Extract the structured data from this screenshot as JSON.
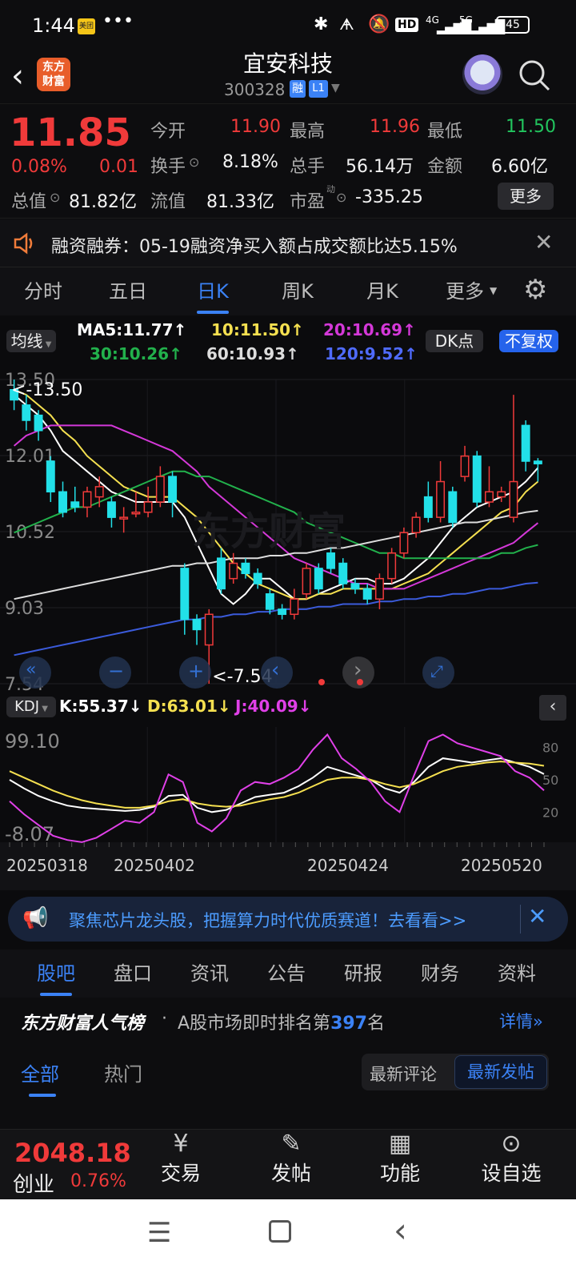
{
  "status": {
    "time": "1:44",
    "app_badge": "美团",
    "dots": "•••",
    "hd": "HD",
    "net1": "4G",
    "net2": "5G",
    "battery": "45"
  },
  "header": {
    "logo_line1": "东方",
    "logo_line2": "财富",
    "stock_name": "宜安科技",
    "stock_code": "300328",
    "tag_rong": "融",
    "tag_l1": "L1"
  },
  "quote": {
    "price": "11.85",
    "change_pct": "0.08%",
    "change": "0.01",
    "open_label": "今开",
    "open": "11.90",
    "high_label": "最高",
    "high": "11.96",
    "low_label": "最低",
    "low": "11.50",
    "turnover_label": "换手",
    "turnover": "8.18%",
    "volume_label": "总手",
    "volume": "56.14万",
    "amount_label": "金额",
    "amount": "6.60亿",
    "mcap_label": "总值",
    "mcap": "81.82亿",
    "float_label": "流值",
    "float": "81.33亿",
    "pe_label": "市盈",
    "pe_sup": "动",
    "pe": "-335.25",
    "more_button": "更多"
  },
  "notice": {
    "text": "融资融券：05-19融资净买入额占成交额比达5.15%"
  },
  "period_tabs": [
    {
      "label": "分时"
    },
    {
      "label": "五日"
    },
    {
      "label": "日K"
    },
    {
      "label": "周K"
    },
    {
      "label": "月K"
    },
    {
      "label": "更多"
    }
  ],
  "ma_legend": {
    "selector": "均线",
    "ma5": "MA5:11.77",
    "ma10": "10:11.50",
    "ma20": "20:10.69",
    "ma30": "30:10.26",
    "ma60": "60:10.93",
    "ma120": "120:9.52",
    "dk_button": "DK点",
    "fq_button": "不复权"
  },
  "colors": {
    "up": "#f03a3a",
    "down": "#22e0e8",
    "ma5": "#ffffff",
    "ma10": "#f5e050",
    "ma20": "#d438d8",
    "ma30": "#22b14c",
    "ma60": "#dddddd",
    "ma120": "#3b5bdb",
    "accent": "#3b82f6"
  },
  "chart_data": [
    {
      "type": "candlestick",
      "y_ticks": [
        "13.50",
        "12.01",
        "10.52",
        "9.03",
        "7.54"
      ],
      "ylim": [
        7.54,
        13.5
      ],
      "high_marker": "<-13.50",
      "low_marker": "<-7.54",
      "x_labels": [
        "20250318",
        "20250402",
        "20250424",
        "20250520"
      ],
      "candles": [
        {
          "o": 13.3,
          "c": 13.1,
          "h": 13.5,
          "l": 12.9
        },
        {
          "o": 13.0,
          "c": 12.7,
          "h": 13.2,
          "l": 12.5
        },
        {
          "o": 12.8,
          "c": 12.5,
          "h": 12.9,
          "l": 12.3
        },
        {
          "o": 11.9,
          "c": 11.3,
          "h": 12.0,
          "l": 11.1
        },
        {
          "o": 11.3,
          "c": 10.9,
          "h": 11.5,
          "l": 10.8
        },
        {
          "o": 11.1,
          "c": 11.0,
          "h": 11.4,
          "l": 10.9
        },
        {
          "o": 11.0,
          "c": 11.3,
          "h": 11.4,
          "l": 10.8
        },
        {
          "o": 11.2,
          "c": 11.4,
          "h": 11.6,
          "l": 11.0
        },
        {
          "o": 11.1,
          "c": 10.8,
          "h": 11.2,
          "l": 10.6
        },
        {
          "o": 10.8,
          "c": 10.8,
          "h": 11.0,
          "l": 10.5
        },
        {
          "o": 10.9,
          "c": 10.9,
          "h": 11.3,
          "l": 10.8
        },
        {
          "o": 10.9,
          "c": 11.1,
          "h": 11.4,
          "l": 10.8
        },
        {
          "o": 11.1,
          "c": 11.6,
          "h": 11.8,
          "l": 11.0
        },
        {
          "o": 11.6,
          "c": 11.1,
          "h": 11.7,
          "l": 10.8
        },
        {
          "o": 9.8,
          "c": 8.8,
          "h": 9.9,
          "l": 8.5
        },
        {
          "o": 8.8,
          "c": 8.6,
          "h": 8.9,
          "l": 8.3
        },
        {
          "o": 8.3,
          "c": 8.9,
          "h": 9.0,
          "l": 7.54
        },
        {
          "o": 10.0,
          "c": 9.4,
          "h": 10.2,
          "l": 9.3
        },
        {
          "o": 9.6,
          "c": 9.9,
          "h": 10.1,
          "l": 9.5
        },
        {
          "o": 9.9,
          "c": 9.7,
          "h": 10.0,
          "l": 9.6
        },
        {
          "o": 9.7,
          "c": 9.5,
          "h": 9.8,
          "l": 9.4
        },
        {
          "o": 9.3,
          "c": 9.0,
          "h": 9.4,
          "l": 8.9
        },
        {
          "o": 9.0,
          "c": 8.9,
          "h": 9.1,
          "l": 8.8
        },
        {
          "o": 8.9,
          "c": 9.2,
          "h": 9.4,
          "l": 8.8
        },
        {
          "o": 9.3,
          "c": 9.8,
          "h": 9.9,
          "l": 9.2
        },
        {
          "o": 9.8,
          "c": 9.4,
          "h": 9.9,
          "l": 9.3
        },
        {
          "o": 10.1,
          "c": 9.8,
          "h": 10.2,
          "l": 9.7
        },
        {
          "o": 9.9,
          "c": 9.5,
          "h": 10.0,
          "l": 9.4
        },
        {
          "o": 9.5,
          "c": 9.4,
          "h": 9.6,
          "l": 9.3
        },
        {
          "o": 9.4,
          "c": 9.2,
          "h": 9.5,
          "l": 9.1
        },
        {
          "o": 9.2,
          "c": 9.6,
          "h": 9.7,
          "l": 9.0
        },
        {
          "o": 9.6,
          "c": 10.1,
          "h": 10.2,
          "l": 9.5
        },
        {
          "o": 10.1,
          "c": 10.5,
          "h": 10.6,
          "l": 10.0
        },
        {
          "o": 10.5,
          "c": 10.8,
          "h": 10.9,
          "l": 10.4
        },
        {
          "o": 11.2,
          "c": 10.8,
          "h": 11.5,
          "l": 10.7
        },
        {
          "o": 10.8,
          "c": 11.5,
          "h": 11.9,
          "l": 10.7
        },
        {
          "o": 11.3,
          "c": 10.7,
          "h": 11.4,
          "l": 10.6
        },
        {
          "o": 11.6,
          "c": 12.0,
          "h": 12.2,
          "l": 11.5
        },
        {
          "o": 12.0,
          "c": 11.1,
          "h": 12.1,
          "l": 11.0
        },
        {
          "o": 11.1,
          "c": 11.3,
          "h": 11.8,
          "l": 11.0
        },
        {
          "o": 11.2,
          "c": 11.3,
          "h": 11.4,
          "l": 11.1
        },
        {
          "o": 10.8,
          "c": 11.5,
          "h": 13.2,
          "l": 10.7
        },
        {
          "o": 12.6,
          "c": 11.9,
          "h": 12.7,
          "l": 11.7
        },
        {
          "o": 11.9,
          "c": 11.85,
          "h": 11.96,
          "l": 11.5
        }
      ],
      "ma_series": [
        {
          "name": "MA5",
          "values": [
            13.2,
            13.0,
            12.8,
            12.5,
            12.1,
            11.9,
            11.7,
            11.5,
            11.3,
            11.2,
            11.1,
            11.1,
            11.1,
            11.1,
            10.8,
            10.3,
            9.8,
            9.3,
            9.1,
            9.3,
            9.6,
            9.6,
            9.4,
            9.2,
            9.2,
            9.3,
            9.4,
            9.5,
            9.6,
            9.6,
            9.5,
            9.5,
            9.6,
            9.8,
            10.0,
            10.3,
            10.6,
            10.8,
            11.0,
            11.1,
            11.2,
            11.3,
            11.5,
            11.77
          ]
        },
        {
          "name": "MA10",
          "values": [
            13.3,
            13.2,
            13.0,
            12.8,
            12.5,
            12.3,
            12.0,
            11.8,
            11.6,
            11.4,
            11.3,
            11.2,
            11.2,
            11.2,
            11.0,
            10.8,
            10.5,
            10.2,
            9.9,
            9.7,
            9.5,
            9.4,
            9.3,
            9.2,
            9.2,
            9.3,
            9.3,
            9.4,
            9.4,
            9.4,
            9.4,
            9.4,
            9.5,
            9.6,
            9.7,
            9.9,
            10.1,
            10.3,
            10.5,
            10.7,
            10.9,
            11.0,
            11.3,
            11.5
          ]
        },
        {
          "name": "MA20",
          "values": [
            12.2,
            12.4,
            12.5,
            12.6,
            12.6,
            12.6,
            12.6,
            12.6,
            12.6,
            12.5,
            12.4,
            12.3,
            12.2,
            12.1,
            11.9,
            11.7,
            11.4,
            11.2,
            11.0,
            10.8,
            10.6,
            10.4,
            10.2,
            10.0,
            9.9,
            9.8,
            9.7,
            9.6,
            9.5,
            9.5,
            9.4,
            9.4,
            9.4,
            9.5,
            9.6,
            9.7,
            9.8,
            9.9,
            10.0,
            10.1,
            10.2,
            10.3,
            10.5,
            10.69
          ]
        },
        {
          "name": "MA30",
          "values": [
            10.5,
            10.6,
            10.7,
            10.8,
            10.9,
            11.0,
            11.0,
            11.1,
            11.2,
            11.3,
            11.4,
            11.5,
            11.6,
            11.7,
            11.7,
            11.6,
            11.6,
            11.5,
            11.4,
            11.3,
            11.2,
            11.1,
            11.0,
            10.9,
            10.7,
            10.6,
            10.5,
            10.4,
            10.3,
            10.2,
            10.1,
            10.1,
            10.0,
            10.0,
            10.0,
            10.0,
            10.0,
            10.0,
            10.0,
            10.0,
            10.1,
            10.1,
            10.2,
            10.26
          ]
        },
        {
          "name": "MA60",
          "values": [
            9.2,
            9.25,
            9.3,
            9.35,
            9.4,
            9.45,
            9.5,
            9.55,
            9.6,
            9.65,
            9.7,
            9.75,
            9.8,
            9.85,
            9.85,
            9.9,
            9.9,
            9.95,
            10.0,
            10.0,
            10.0,
            10.05,
            10.05,
            10.1,
            10.1,
            10.15,
            10.2,
            10.2,
            10.25,
            10.3,
            10.35,
            10.4,
            10.45,
            10.5,
            10.55,
            10.6,
            10.65,
            10.7,
            10.7,
            10.75,
            10.8,
            10.85,
            10.9,
            10.93
          ]
        },
        {
          "name": "MA120",
          "values": [
            8.1,
            8.15,
            8.2,
            8.25,
            8.3,
            8.35,
            8.4,
            8.45,
            8.5,
            8.55,
            8.6,
            8.65,
            8.7,
            8.75,
            8.8,
            8.8,
            8.85,
            8.85,
            8.9,
            8.9,
            8.95,
            8.95,
            9.0,
            9.0,
            9.0,
            9.05,
            9.05,
            9.1,
            9.1,
            9.1,
            9.15,
            9.15,
            9.2,
            9.2,
            9.25,
            9.25,
            9.3,
            9.3,
            9.35,
            9.4,
            9.4,
            9.45,
            9.5,
            9.52
          ]
        }
      ]
    },
    {
      "type": "line",
      "label": "KDJ",
      "k_label": "K:55.37",
      "d_label": "D:63.01",
      "j_label": "J:40.09",
      "y_ticks_left": [
        "99.10",
        "-8.07"
      ],
      "y_ticks_right": [
        "80",
        "50",
        "20"
      ],
      "ylim": [
        -8.07,
        99.1
      ],
      "series": [
        {
          "name": "K",
          "values": [
            50,
            42,
            35,
            30,
            26,
            24,
            23,
            22,
            21,
            22,
            25,
            35,
            36,
            24,
            20,
            22,
            28,
            34,
            36,
            38,
            44,
            52,
            62,
            58,
            54,
            50,
            42,
            38,
            48,
            62,
            70,
            68,
            66,
            68,
            70,
            66,
            62,
            55.37
          ]
        },
        {
          "name": "D",
          "values": [
            58,
            52,
            46,
            40,
            35,
            31,
            28,
            26,
            24,
            24,
            26,
            30,
            32,
            28,
            26,
            25,
            26,
            29,
            32,
            34,
            38,
            44,
            50,
            52,
            52,
            50,
            46,
            43,
            46,
            52,
            58,
            62,
            64,
            66,
            67,
            66,
            65,
            63.01
          ]
        },
        {
          "name": "J",
          "values": [
            30,
            18,
            8,
            -2,
            -6,
            -8,
            -4,
            4,
            12,
            10,
            20,
            55,
            48,
            10,
            2,
            14,
            40,
            48,
            46,
            52,
            60,
            78,
            92,
            70,
            60,
            48,
            30,
            20,
            54,
            86,
            92,
            84,
            80,
            76,
            72,
            58,
            52,
            40.09
          ]
        }
      ]
    }
  ],
  "ad": {
    "text": "聚焦芯片龙头股，把握算力时代优质赛道！去看看>>"
  },
  "sub_tabs": [
    {
      "label": "股吧"
    },
    {
      "label": "盘口"
    },
    {
      "label": "资讯"
    },
    {
      "label": "公告"
    },
    {
      "label": "研报"
    },
    {
      "label": "财务"
    },
    {
      "label": "资料"
    }
  ],
  "rank": {
    "title": "东方财富人气榜",
    "dot": "·",
    "desc_prefix": "A股市场即时排名第",
    "rank_no": "397",
    "desc_suffix": "名",
    "detail": "详情"
  },
  "post_tabs": {
    "all": "全部",
    "hot": "热门",
    "latest_comment": "最新评论",
    "latest_post": "最新发帖"
  },
  "bottom": {
    "index_value": "2048.18",
    "index_name": "创业",
    "index_change": "0.76%",
    "trade": "交易",
    "post": "发帖",
    "features": "功能",
    "watchlist": "设自选"
  }
}
